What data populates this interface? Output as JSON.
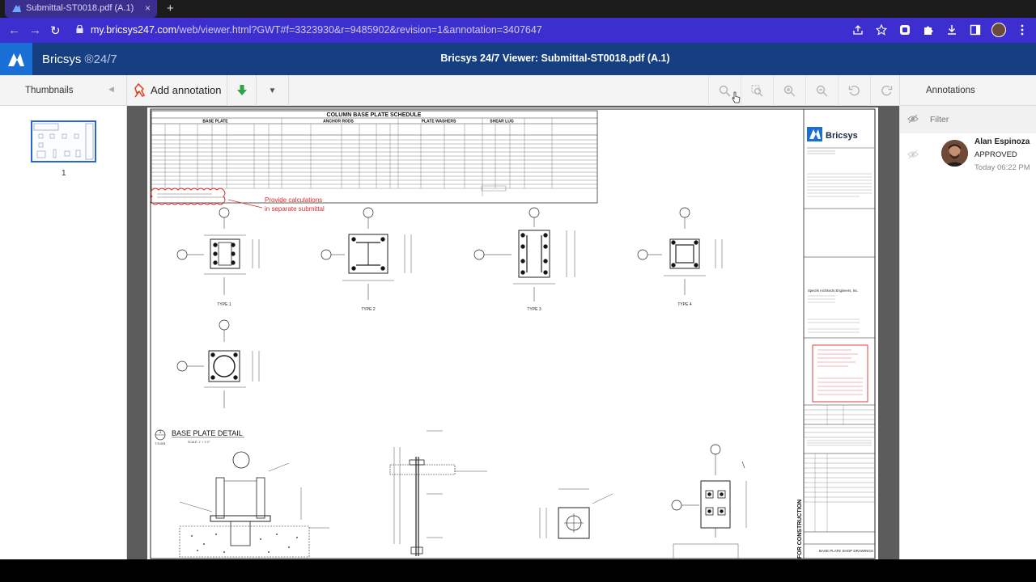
{
  "browser": {
    "tab_title": "Submittal-ST0018.pdf (A.1)",
    "tab_close": "×",
    "new_tab": "+",
    "url_host": "my.bricsys247.com",
    "url_path": "/web/viewer.html?GWT#f=3323930&r=9485902&revision=1&annotation=3407647",
    "nav_back": "←",
    "nav_forward": "→",
    "nav_reload": "↻"
  },
  "app": {
    "brand_name": "Bricsys",
    "brand_suffix": "®24/7",
    "viewer_title": "Bricsys 24/7 Viewer: Submittal-ST0018.pdf (A.1)",
    "accent_color": "#153f80",
    "logo_color": "#1a6fd6"
  },
  "toolbar": {
    "thumbnails_label": "Thumbnails",
    "add_annotation_label": "Add annotation",
    "annotations_label": "Annotations",
    "zoom_tools": [
      "zoom-fit-icon",
      "zoom-area-icon",
      "zoom-in-icon",
      "zoom-out-icon",
      "rotate-left-icon",
      "rotate-right-icon"
    ]
  },
  "thumbnails": {
    "page_number": "1"
  },
  "annotations": {
    "filter_placeholder": "Filter",
    "items": [
      {
        "user": "Alan Espinoza",
        "status": "APPROVED",
        "time": "Today 06:22 PM"
      }
    ]
  },
  "drawing": {
    "schedule_title": "COLUMN BASE PLATE SCHEDULE",
    "group_base_plate": "BASE PLATE",
    "group_anchor_rods": "ANCHOR RODS",
    "group_plate_washers": "PLATE WASHERS",
    "group_shear_lug": "SHEAR LUG",
    "markup_text_line1": "Provide calculations",
    "markup_text_line2": "in separate submittal",
    "type_labels": [
      "TYPE 1",
      "TYPE 2",
      "TYPE 3",
      "TYPE 4",
      "TYPE 5"
    ],
    "detail_number": "1",
    "detail_ref": "7.5-001",
    "detail_title": "BASE PLATE DETAIL",
    "detail_scale": "SCALE: 1\" = 1'-0\"",
    "titleblock_brand": "Bricsys",
    "titleblock_firm": "Specirk Architects Engineers, Inc.",
    "for_construction": "FOR CONSTRUCTION",
    "sheet_name": "BASE PLATE SHOP DRAWINGS",
    "markup_color": "#d92b2b"
  }
}
